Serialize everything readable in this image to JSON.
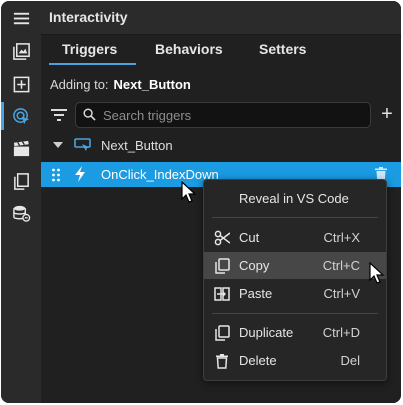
{
  "panel": {
    "title": "Interactivity"
  },
  "tabs": [
    {
      "label": "Triggers",
      "active": true
    },
    {
      "label": "Behaviors"
    },
    {
      "label": "Setters"
    }
  ],
  "adding_to": {
    "prefix": "Adding to:",
    "target": "Next_Button"
  },
  "search": {
    "placeholder": "Search triggers"
  },
  "add_label": "+",
  "tree": {
    "node_label": "Next_Button"
  },
  "trigger": {
    "label": "OnClick_IndexDown"
  },
  "context_menu": {
    "reveal_label": "Reveal in VS Code",
    "items": [
      {
        "label": "Cut",
        "shortcut": "Ctrl+X",
        "icon": "scissors-icon"
      },
      {
        "label": "Copy",
        "shortcut": "Ctrl+C",
        "icon": "copy-icon",
        "hovered": true
      },
      {
        "label": "Paste",
        "shortcut": "Ctrl+V",
        "icon": "paste-icon"
      },
      {
        "label": "Duplicate",
        "shortcut": "Ctrl+D",
        "icon": "duplicate-icon"
      },
      {
        "label": "Delete",
        "shortcut": "Del",
        "icon": "trash-icon"
      }
    ]
  },
  "colors": {
    "accent": "#4aa3df",
    "selection": "#1a9be2",
    "panel_bg": "#202020",
    "menu_hover": "#474747"
  }
}
